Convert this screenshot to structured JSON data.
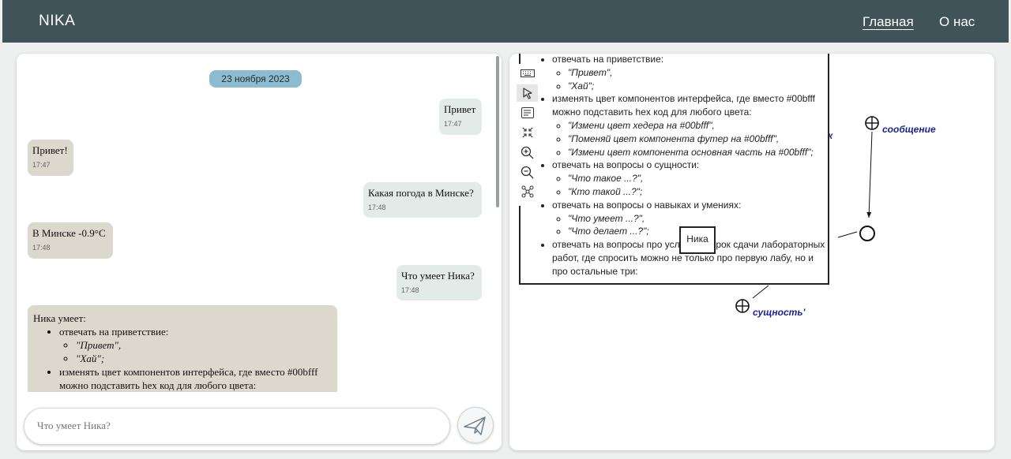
{
  "header": {
    "brand": "NIKA",
    "nav_main": "Главная",
    "nav_about": "О нас"
  },
  "chat": {
    "date": "23 ноября 2023",
    "messages": [
      {
        "side": "out",
        "text": "Привет",
        "time": "17:47"
      },
      {
        "side": "in",
        "text": "Привет!",
        "time": "17:47"
      },
      {
        "side": "out",
        "text": "Какая погода в Минске?",
        "time": "17:48"
      },
      {
        "side": "in",
        "text": "В Минске -0.9°C",
        "time": "17:48"
      },
      {
        "side": "out",
        "text": "Что умеет Ника?",
        "time": "17:48"
      }
    ],
    "long_message": {
      "intro": "Ника умеет:",
      "item1": "отвечать на приветствие:",
      "item1_sub1": "\"Привет\",",
      "item1_sub2": "\"Хай\";",
      "item2": "изменять цвет компонентов интерфейса, где вместо #00bfff можно подставить hex код для любого цвета:"
    },
    "input_placeholder": "Что умеет Ника?"
  },
  "graph": {
    "popup": {
      "i1": "отвечать на приветствие:",
      "i1_s1": "\"Привет\",",
      "i1_s2": "\"Хай\";",
      "i2": "изменять цвет компонентов интерфейса, где вместо #00bfff можно подставить hex код для любого цвета:",
      "i2_s1": "\"Измени цвет хедера на #00bfff\",",
      "i2_s2": "\"Поменяй цвет компонента футер на #00bfff\",",
      "i2_s3": "\"Измени цвет компонента основная часть на #00bfff\";",
      "i3": "отвечать на вопросы о сущности:",
      "i3_s1": "\"Что такое ...?\",",
      "i3_s2": "\"Кто такой ...?\";",
      "i4": "отвечать на вопросы о навыках и умениях:",
      "i4_s1": "\"Что умеет ...?\",",
      "i4_s2": "\"Что делает ...?\";",
      "i5": "отвечать на вопросы про условия и срок сдачи лабораторных работ, где спросить можно не только про первую лабу, но и про остальные три:"
    },
    "nika_label": "Ника",
    "node_message": "сообщение",
    "node_entity": "сущность'",
    "partial_label": "к",
    "toolbar": [
      "keyboard-icon",
      "pointer-icon",
      "text-icon",
      "collapse-icon",
      "zoom-in-icon",
      "zoom-out-icon",
      "graph-icon"
    ]
  }
}
